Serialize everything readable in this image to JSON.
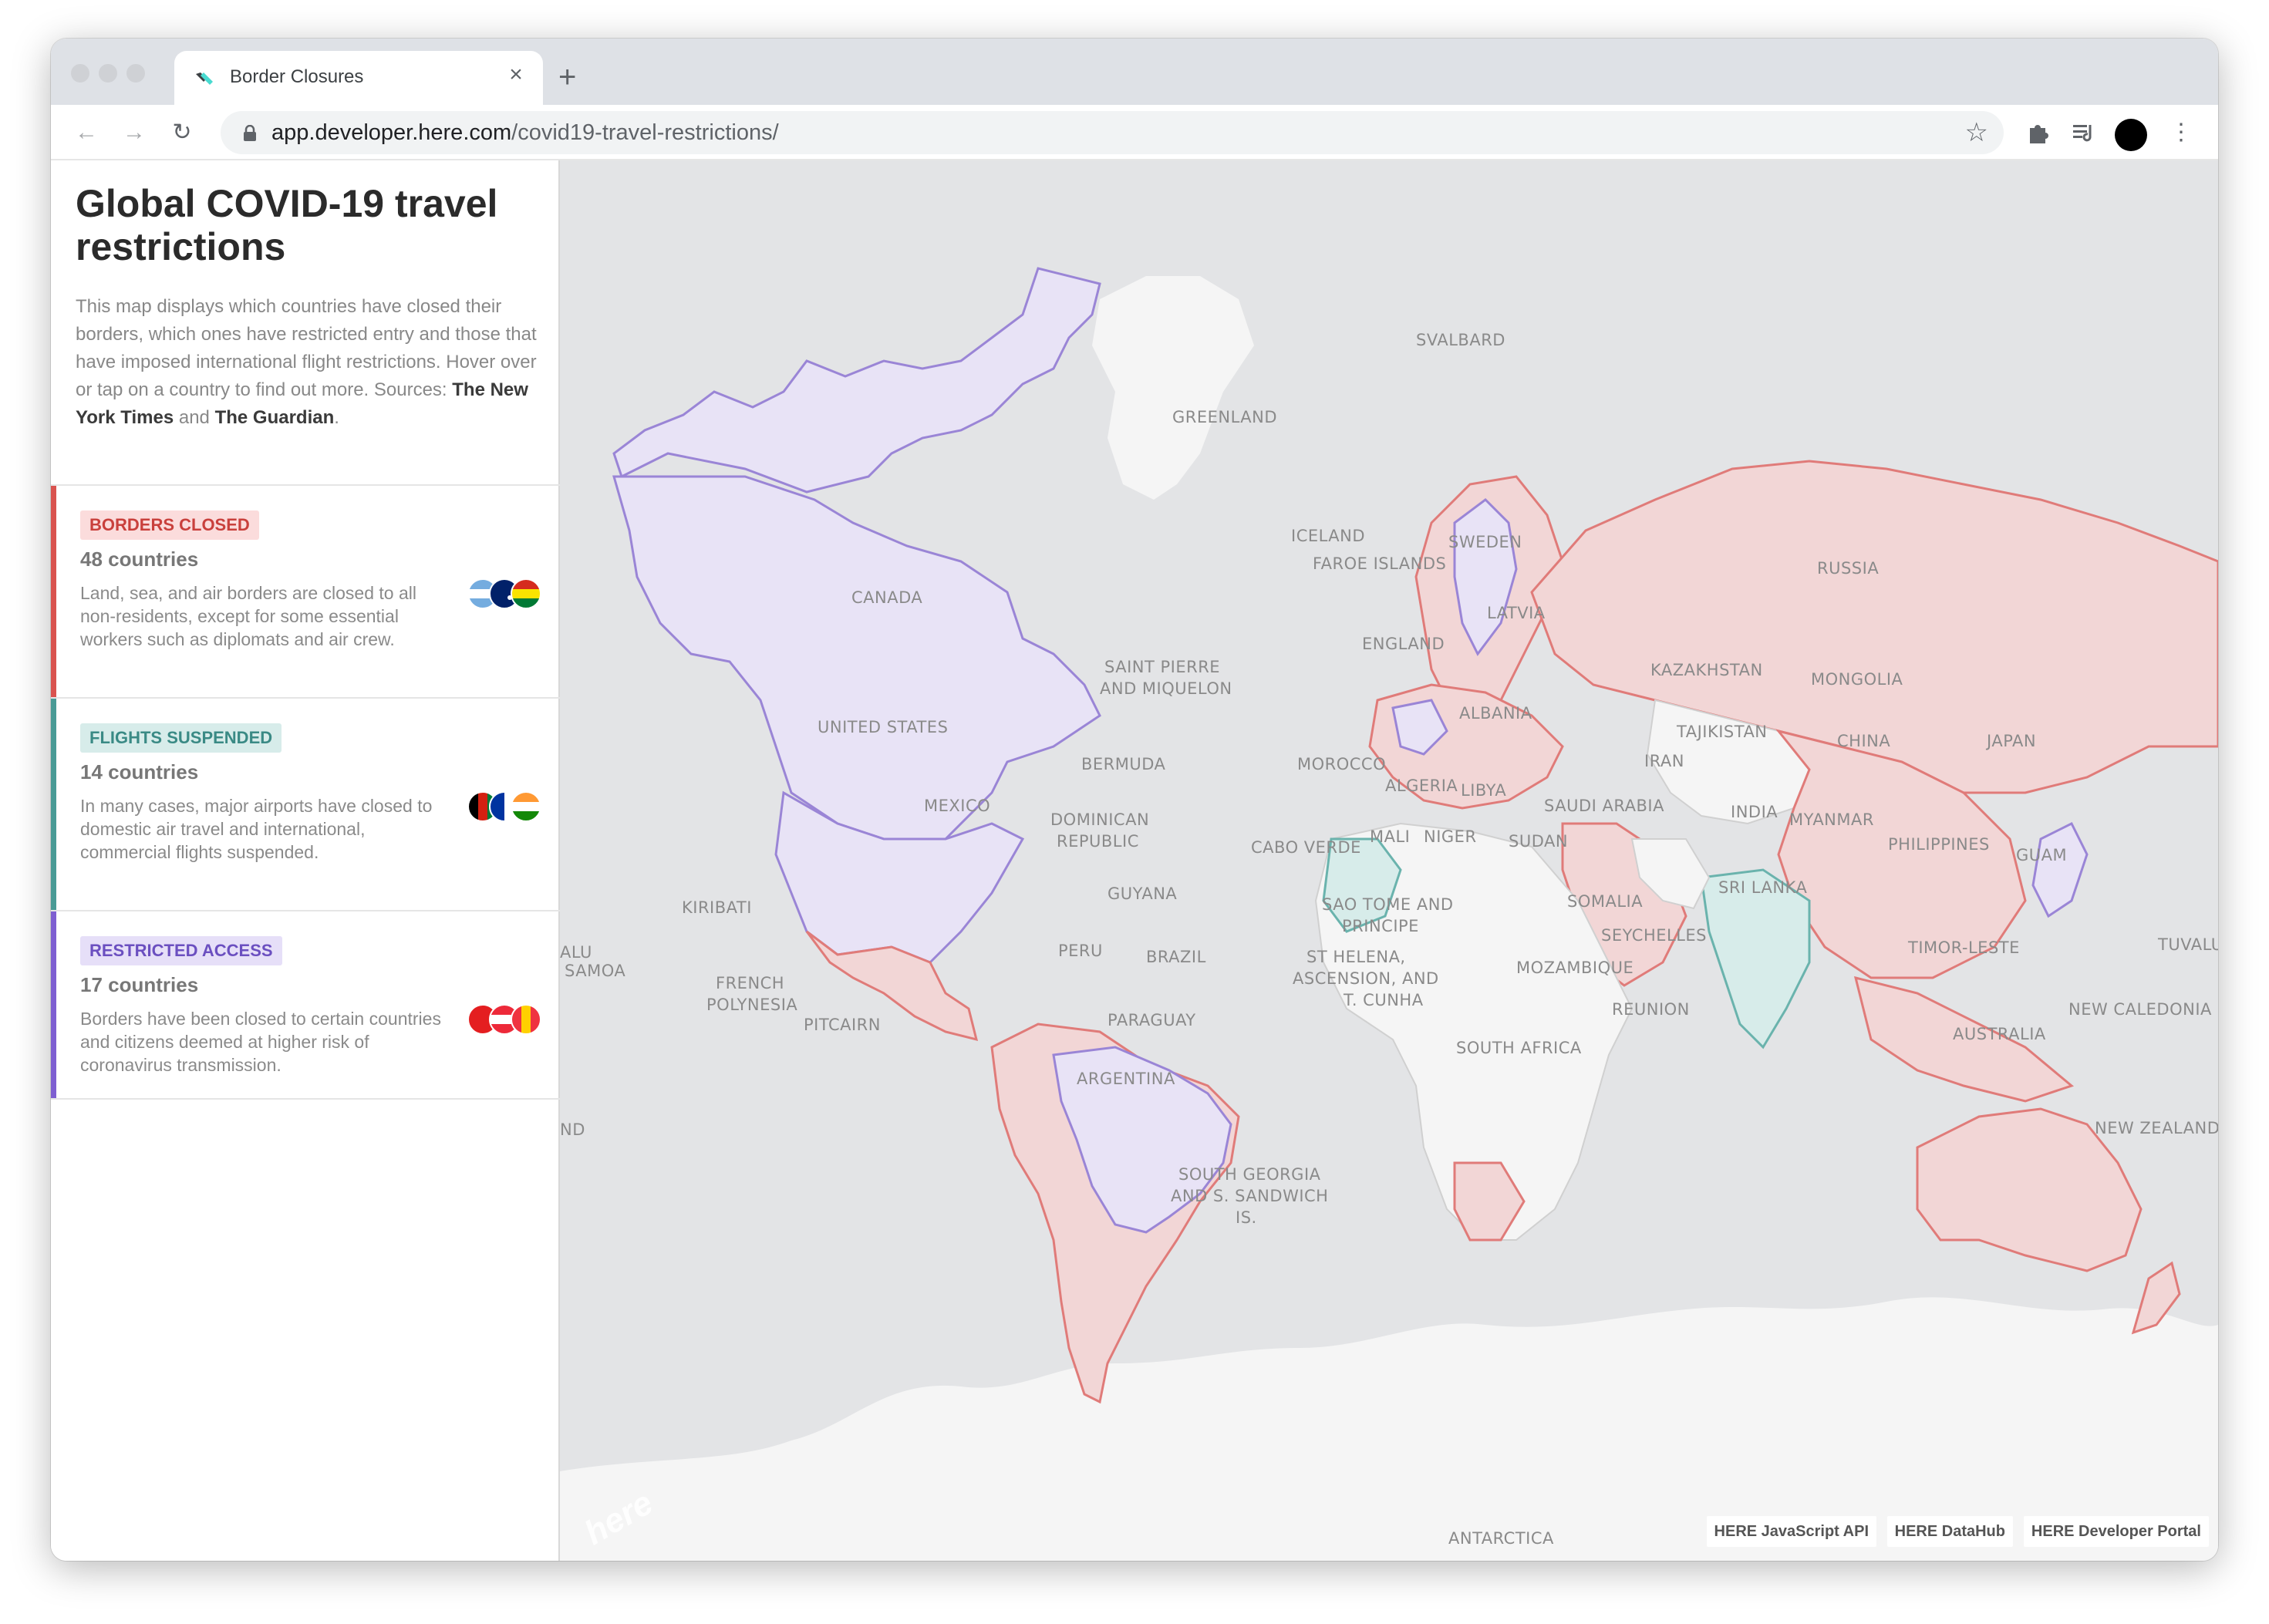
{
  "browser": {
    "tab_title": "Border Closures",
    "tab_icon": "here-logo-icon",
    "close_icon": "×",
    "new_tab_icon": "+",
    "url_host": "app.developer.here.com",
    "url_path": "/covid19-travel-restrictions/"
  },
  "sidebar": {
    "title": "Global COVID-19 travel restrictions",
    "description_intro": "This map displays which countries have closed their borders, which ones have restricted entry and those that have imposed international flight restrictions. Hover over or tap on a country to find out more. Sources: ",
    "source_1": "The New York Times",
    "description_and": " and ",
    "source_2": "The Guardian",
    "description_end": ".",
    "legend": [
      {
        "badge": "BORDERS CLOSED",
        "count": "48 countries",
        "description": "Land, sea, and air borders are closed to all non-residents, except for some essential workers such as diplomats and air crew.",
        "color": "#d9534f",
        "badge_bg": "#fbdcdc",
        "badge_fg": "#c9403c"
      },
      {
        "badge": "FLIGHTS SUSPENDED",
        "count": "14 countries",
        "description": "In many cases, major airports have closed to domestic air travel and international, commercial flights suspended.",
        "color": "#4a9b96",
        "badge_bg": "#d7ecea",
        "badge_fg": "#3a8a85"
      },
      {
        "badge": "RESTRICTED ACCESS",
        "count": "17 countries",
        "description": "Borders have been closed to certain countries and citizens deemed at higher risk of coronavirus transmission.",
        "color": "#7e5fd1",
        "badge_bg": "#e6dff8",
        "badge_fg": "#6b4fc0"
      }
    ]
  },
  "map": {
    "labels": [
      "SVALBARD",
      "GREENLAND",
      "ICELAND",
      "FAROE ISLANDS",
      "SWEDEN",
      "RUSSIA",
      "CANADA",
      "LATVIA",
      "ENGLAND",
      "KAZAKHSTAN",
      "MONGOLIA",
      "SAINT PIERRE",
      "AND MIQUELON",
      "UNITED STATES",
      "ALBANIA",
      "TAJIKISTAN",
      "IRAN",
      "CHINA",
      "JAPAN",
      "BERMUDA",
      "MOROCCO",
      "ALGERIA",
      "LIBYA",
      "SAUDI ARABIA",
      "INDIA",
      "MYANMAR",
      "MEXICO",
      "DOMINICAN",
      "REPUBLIC",
      "CABO VERDE",
      "MALI",
      "NIGER",
      "SUDAN",
      "PHILIPPINES",
      "GUAM",
      "KIRIBATI",
      "GUYANA",
      "SRI LANKA",
      "SOMALIA",
      "SAO TOME AND",
      "PRINCIPE",
      "SEYCHELLES",
      "PERU",
      "BRAZIL",
      "ST HELENA,",
      "ASCENSION, AND",
      "T. CUNHA",
      "MOZAMBIQUE",
      "TIMOR-LESTE",
      "TUVALU",
      "SAMOA",
      "FRENCH",
      "POLYNESIA",
      "PITCAIRN",
      "PARAGUAY",
      "REUNION",
      "AUSTRALIA",
      "NEW CALEDONIA",
      "ARGENTINA",
      "SOUTH AFRICA",
      "NEW ZEALAND",
      "SOUTH GEORGIA",
      "AND S. SANDWICH",
      "IS.",
      "ANTARCTICA",
      "ALU",
      "ND"
    ],
    "attributions": [
      "HERE JavaScript API",
      "HERE DataHub",
      "HERE Developer Portal"
    ],
    "logo_text": "here"
  }
}
